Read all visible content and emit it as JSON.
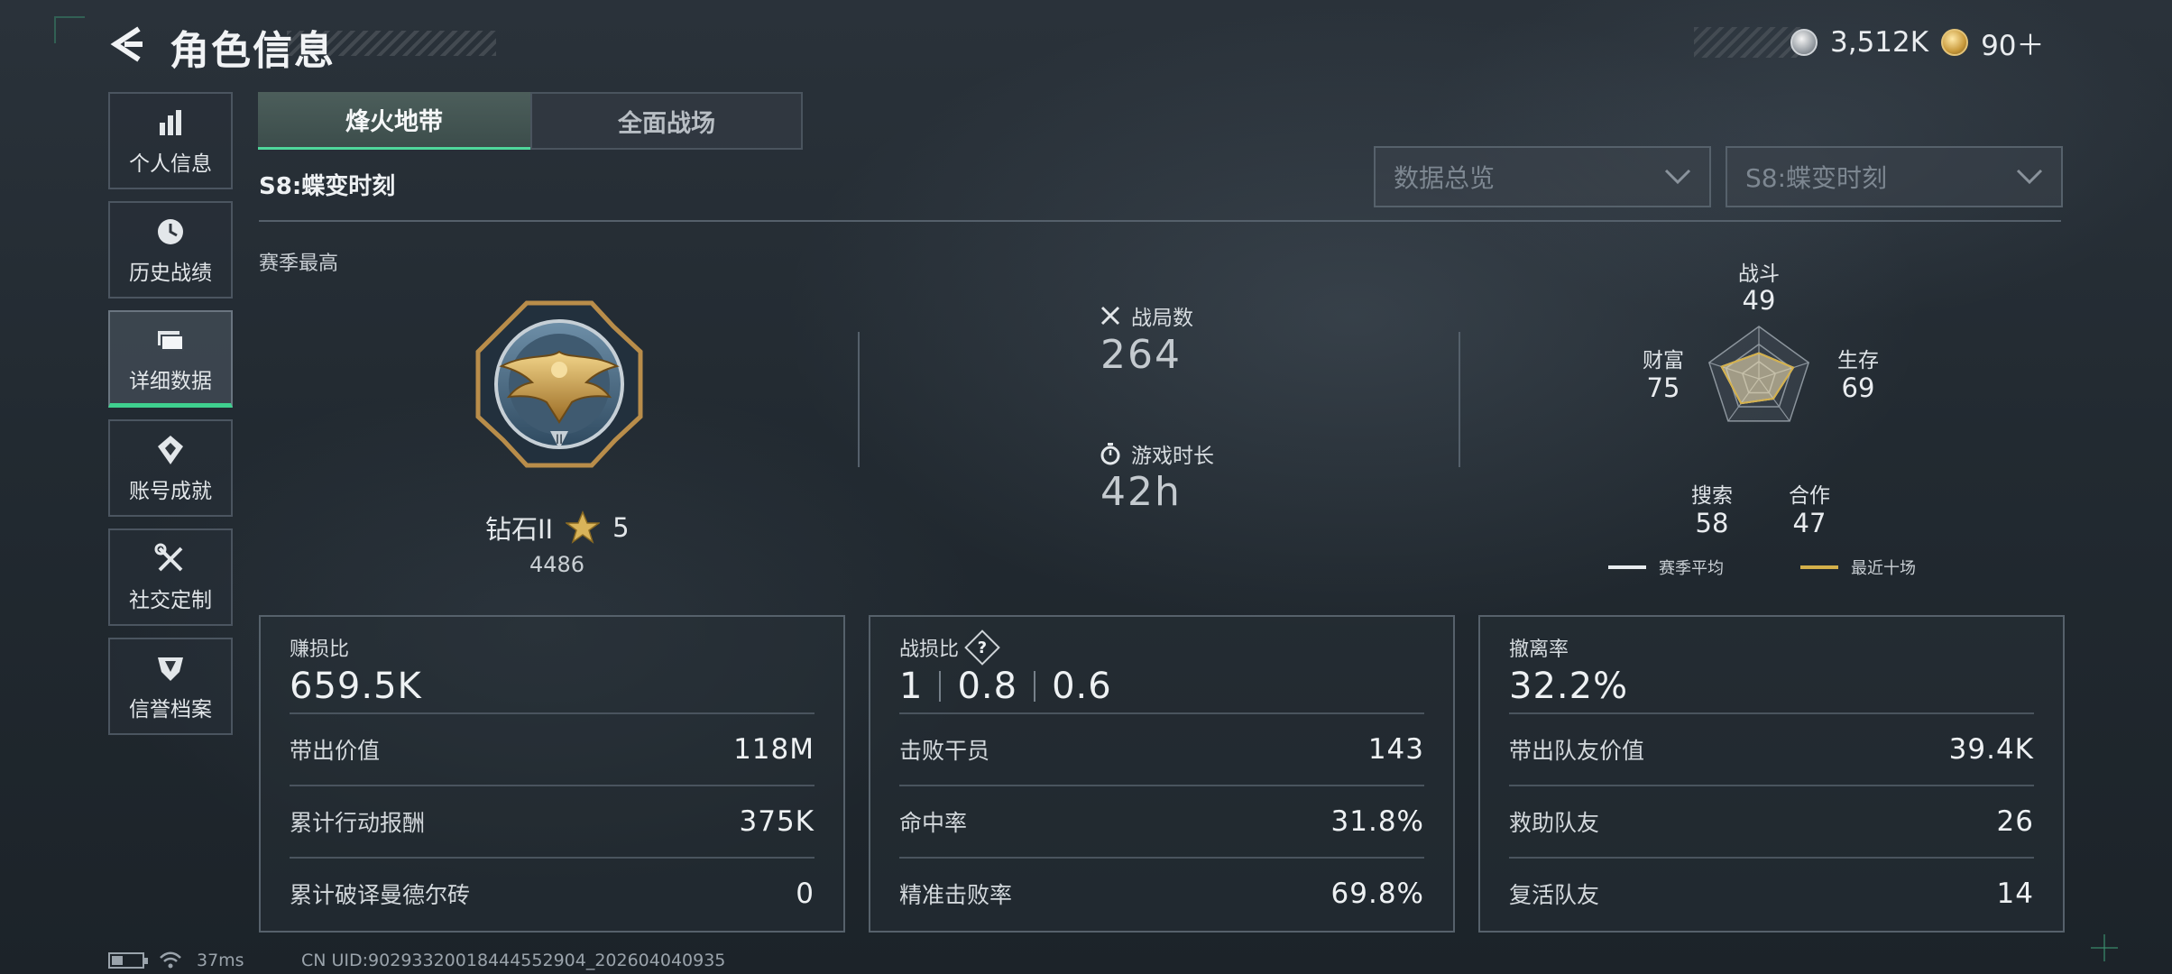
{
  "header": {
    "title": "角色信息",
    "currency": [
      {
        "icon": "silver-coin-icon",
        "value": "3,512K"
      },
      {
        "icon": "gold-ticket-icon",
        "value": "90＋"
      }
    ]
  },
  "sidebar": {
    "items": [
      {
        "label": "个人信息",
        "icon": "bar-chart-icon",
        "active": false
      },
      {
        "label": "历史战绩",
        "icon": "clock-icon",
        "active": false
      },
      {
        "label": "详细数据",
        "icon": "folder-icon",
        "active": true
      },
      {
        "label": "账号成就",
        "icon": "achievement-icon",
        "active": false
      },
      {
        "label": "社交定制",
        "icon": "tools-icon",
        "active": false
      },
      {
        "label": "信誉档案",
        "icon": "shield-icon",
        "active": false
      }
    ]
  },
  "tabs": [
    {
      "label": "烽火地带",
      "active": true
    },
    {
      "label": "全面战场",
      "active": false
    }
  ],
  "season_title": "S8:蝶变时刻",
  "filters": {
    "view": "数据总览",
    "season": "S8:蝶变时刻"
  },
  "overview": {
    "section_label": "赛季最高",
    "rank": {
      "name": "钻石II",
      "stars": "5",
      "points": "4486"
    },
    "matches": {
      "label": "战局数",
      "value": "264"
    },
    "playtime": {
      "label": "游戏时长",
      "value": "42h"
    }
  },
  "radar": {
    "axes": [
      {
        "label": "战斗",
        "value": "49"
      },
      {
        "label": "生存",
        "value": "69"
      },
      {
        "label": "合作",
        "value": "47"
      },
      {
        "label": "搜索",
        "value": "58"
      },
      {
        "label": "财富",
        "value": "75"
      }
    ],
    "legend": [
      {
        "label": "赛季平均",
        "color": "#e8ecef"
      },
      {
        "label": "最近十场",
        "color": "#d4b04a"
      }
    ]
  },
  "cards": [
    {
      "title": "赚损比",
      "big": "659.5K",
      "rows": [
        {
          "label": "带出价值",
          "value": "118M"
        },
        {
          "label": "累计行动报酬",
          "value": "375K"
        },
        {
          "label": "累计破译曼德尔砖",
          "value": "0"
        }
      ]
    },
    {
      "title": "战损比",
      "big_parts": [
        "1",
        "0.8",
        "0.6"
      ],
      "rows": [
        {
          "label": "击败干员",
          "value": "143"
        },
        {
          "label": "命中率",
          "value": "31.8%"
        },
        {
          "label": "精准击败率",
          "value": "69.8%"
        }
      ]
    },
    {
      "title": "撤离率",
      "big": "32.2%",
      "rows": [
        {
          "label": "带出队友价值",
          "value": "39.4K"
        },
        {
          "label": "救助队友",
          "value": "26"
        },
        {
          "label": "复活队友",
          "value": "14"
        }
      ]
    }
  ],
  "footer": {
    "ping": "37ms",
    "uid": "CN UID:9029332001844455290​4_202604040935"
  },
  "colors": {
    "accent": "#3fd08f",
    "gold": "#d4b04a"
  }
}
